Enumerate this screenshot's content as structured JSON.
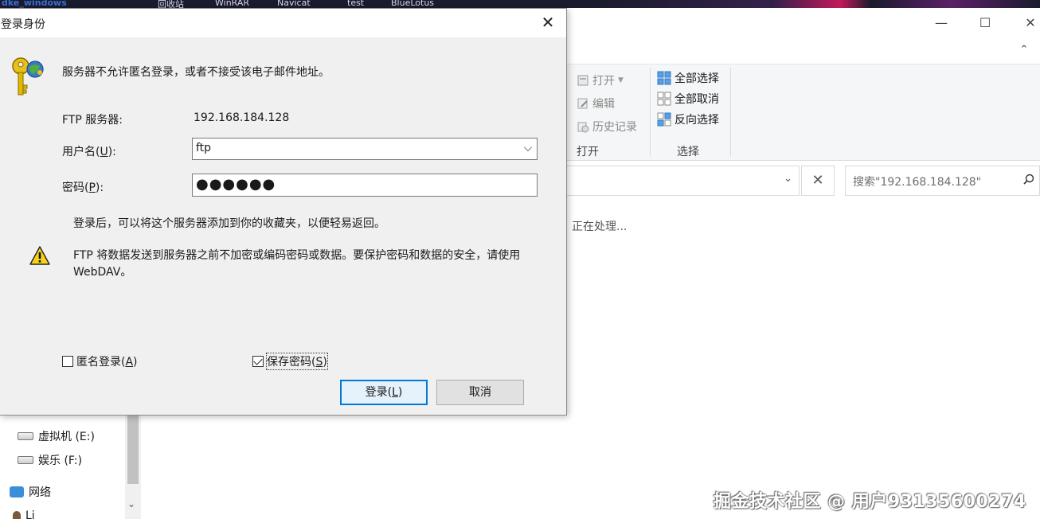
{
  "taskbar": {
    "items": [
      "dke_windows",
      "回收站",
      "WinRAR",
      "Navicat",
      "test",
      "BlueLotus"
    ]
  },
  "explorer": {
    "ribbon": {
      "open_group": {
        "items": [
          "打开",
          "编辑",
          "历史记录"
        ],
        "label": "打开"
      },
      "select_group": {
        "items": [
          "全部选择",
          "全部取消",
          "反向选择"
        ],
        "label": "选择"
      }
    },
    "search_placeholder": "搜索\"192.168.184.128\"",
    "status": "正在处理...",
    "nav": {
      "items": [
        "虚拟机 (E:)",
        "娱乐 (F:)",
        "网络",
        "Li"
      ]
    }
  },
  "dialog": {
    "title": "登录身份",
    "message": "服务器不允许匿名登录，或者不接受该电子邮件地址。",
    "server_label": "FTP 服务器:",
    "server_value": "192.168.184.128",
    "username_label_pre": "用户名(",
    "username_label_key": "U",
    "username_label_post": "):",
    "username_value": "ftp",
    "password_label_pre": "密码(",
    "password_label_key": "P",
    "password_label_post": "):",
    "password_value": "●●●●●●",
    "info": "登录后，可以将这个服务器添加到你的收藏夹，以便轻易返回。",
    "warning_line1": "FTP 将数据发送到服务器之前不加密或编码密码或数据。要保护密码和数据的安全，请使用",
    "warning_line2": "WebDAV。",
    "anonymous_pre": "匿名登录(",
    "anonymous_key": "A",
    "anonymous_post": ")",
    "save_pre": "保存密码(",
    "save_key": "S",
    "save_post": ")",
    "login_pre": "登录(",
    "login_key": "L",
    "login_post": ")",
    "cancel": "取消"
  },
  "watermark": "掘金技术社区 @ 用户93135600274"
}
